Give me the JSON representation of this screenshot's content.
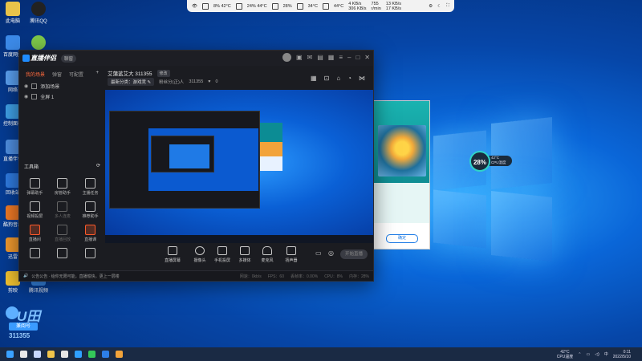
{
  "desktop": {
    "icons": [
      {
        "label": "此电脑"
      },
      {
        "label": "腾讯QQ"
      },
      {
        "label": "百度网盘"
      },
      {
        "label": "网络"
      },
      {
        "label": "控制面板"
      },
      {
        "label": "直播伴侣"
      },
      {
        "label": "回收站"
      },
      {
        "label": "酷狗音乐"
      },
      {
        "label": "迅雷"
      },
      {
        "label": "剪映"
      },
      {
        "label": "腾讯视频"
      }
    ]
  },
  "status_widget": {
    "cpu": "8%",
    "cpu_temp": "42°C",
    "gpu": "24%",
    "gpu_temp": "44°C",
    "mem": "28%",
    "disk_temp": "34°C",
    "hdd": "44°C",
    "net_up": "4 KB/s",
    "net_down": "306 KB/s",
    "fan": "755",
    "fan_unit": "r/min",
    "net2_up": "13 KB/s",
    "net2_down": "17 KB/s"
  },
  "app": {
    "title": "直播伴侣",
    "badge": "聊窗",
    "tabs": [
      "我的场景",
      "弹窗",
      "可配置"
    ],
    "tab_plus": "+",
    "scenes": [
      "添加场景",
      "全屏 1"
    ],
    "tools_title": "工具箱",
    "tools": [
      {
        "label": "弹幕助手",
        "hot": false,
        "dim": false
      },
      {
        "label": "房管助手",
        "hot": false,
        "dim": false
      },
      {
        "label": "主播任务",
        "hot": false,
        "dim": false
      },
      {
        "label": "视频投屏",
        "hot": false,
        "dim": false
      },
      {
        "label": "多人连麦",
        "hot": false,
        "dim": true
      },
      {
        "label": "推荐助手",
        "hot": false,
        "dim": false
      },
      {
        "label": "直播间",
        "hot": true,
        "dim": false
      },
      {
        "label": "直播回放",
        "hot": false,
        "dim": true
      },
      {
        "label": "直播课",
        "hot": true,
        "dim": false
      },
      {
        "label": "",
        "hot": false,
        "dim": false
      },
      {
        "label": "",
        "hot": false,
        "dim": false
      },
      {
        "label": "",
        "hot": false,
        "dim": false
      }
    ],
    "room_title": "艾蒲蓝艾大 311355",
    "edit_label": "修改",
    "category": "最新分类：游戏竞 ✎",
    "fans": "粉丝分(正)人",
    "room_id": "311355",
    "likes": "0",
    "controls": [
      {
        "label": "直播屏幕"
      },
      {
        "label": "摄像头"
      },
      {
        "label": "手机投屏"
      },
      {
        "label": "多媒体"
      },
      {
        "label": "麦克风"
      },
      {
        "label": "扬声器"
      }
    ],
    "start_button": "开始直播",
    "status_message": "公告公告 · 给你无限可能，直播愉快，更上一层楼",
    "stats": [
      "网速：0kb/s",
      "FPS：60",
      "丢帧率：0.00%",
      "CPU：8%",
      "内存：28%"
    ]
  },
  "bg_window": {
    "button": "确定"
  },
  "cpu_gauge": {
    "value": "28%",
    "temp": "42°C",
    "label": "CPU温度"
  },
  "watermark": {
    "brand": "U田",
    "name": "兼阅号",
    "number": "311355"
  },
  "taskbar": {
    "temp": "42°C",
    "temp_label": "CPU温度",
    "time": "0:11",
    "date": "2022/5/10"
  }
}
